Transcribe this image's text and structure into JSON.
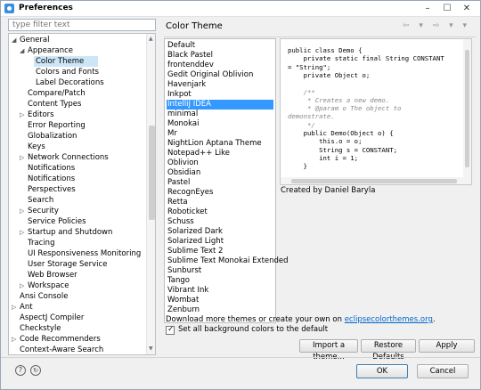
{
  "window": {
    "title": "Preferences"
  },
  "filter": {
    "placeholder": "type filter text"
  },
  "tree": [
    {
      "label": "General",
      "level": 0,
      "expanded": true
    },
    {
      "label": "Appearance",
      "level": 1,
      "expanded": true
    },
    {
      "label": "Color Theme",
      "level": 2,
      "selected": true
    },
    {
      "label": "Colors and Fonts",
      "level": 2
    },
    {
      "label": "Label Decorations",
      "level": 2
    },
    {
      "label": "Compare/Patch",
      "level": 1
    },
    {
      "label": "Content Types",
      "level": 1
    },
    {
      "label": "Editors",
      "level": 1,
      "expandable": true
    },
    {
      "label": "Error Reporting",
      "level": 1
    },
    {
      "label": "Globalization",
      "level": 1
    },
    {
      "label": "Keys",
      "level": 1
    },
    {
      "label": "Network Connections",
      "level": 1,
      "expandable": true
    },
    {
      "label": "Notifications",
      "level": 1
    },
    {
      "label": "Notifications",
      "level": 1
    },
    {
      "label": "Perspectives",
      "level": 1
    },
    {
      "label": "Search",
      "level": 1
    },
    {
      "label": "Security",
      "level": 1,
      "expandable": true
    },
    {
      "label": "Service Policies",
      "level": 1
    },
    {
      "label": "Startup and Shutdown",
      "level": 1,
      "expandable": true
    },
    {
      "label": "Tracing",
      "level": 1
    },
    {
      "label": "UI Responsiveness Monitoring",
      "level": 1
    },
    {
      "label": "User Storage Service",
      "level": 1
    },
    {
      "label": "Web Browser",
      "level": 1
    },
    {
      "label": "Workspace",
      "level": 1,
      "expandable": true
    },
    {
      "label": "Ansi Console",
      "level": 0
    },
    {
      "label": "Ant",
      "level": 0,
      "expandable": true
    },
    {
      "label": "AspectJ Compiler",
      "level": 0
    },
    {
      "label": "Checkstyle",
      "level": 0
    },
    {
      "label": "Code Recommenders",
      "level": 0,
      "expandable": true
    },
    {
      "label": "Context-Aware Search",
      "level": 0
    }
  ],
  "page": {
    "title": "Color Theme",
    "nav_icons": "⇦ ▾ ⇨ ▾ ▾"
  },
  "themes": [
    "Default",
    "Black Pastel",
    "frontenddev",
    "Gedit Original Oblivion",
    "Havenjark",
    "Inkpot",
    "IntelliJ IDEA",
    "minimal",
    "Monokai",
    "Mr",
    "NightLion Aptana Theme",
    "Notepad++ Like",
    "Oblivion",
    "Obsidian",
    "Pastel",
    "RecognEyes",
    "Retta",
    "Roboticket",
    "Schuss",
    "Solarized Dark",
    "Solarized Light",
    "Sublime Text 2",
    "Sublime Text Monokai Extended",
    "Sunburst",
    "Tango",
    "Vibrant Ink",
    "Wombat",
    "Zenburn"
  ],
  "selected_theme": "IntelliJ IDEA",
  "preview": {
    "lines": [
      {
        "text": "public class Demo {",
        "style": "kw"
      },
      {
        "text": "    private static final String CONSTANT",
        "style": "kw"
      },
      {
        "text": "= \"String\";",
        "style": "kw"
      },
      {
        "text": "    private Object o;",
        "style": "kw"
      },
      {
        "text": "",
        "style": "kw"
      },
      {
        "text": "    /**",
        "style": "cm"
      },
      {
        "text": "     * Creates a new demo.",
        "style": "cm"
      },
      {
        "text": "     * @param o The object to",
        "style": "cm"
      },
      {
        "text": "demonstrate.",
        "style": "cm"
      },
      {
        "text": "     */",
        "style": "cm"
      },
      {
        "text": "    public Demo(Object o) {",
        "style": "kw"
      },
      {
        "text": "        this.o = o;",
        "style": "kw"
      },
      {
        "text": "        String s = CONSTANT;",
        "style": "kw"
      },
      {
        "text": "        int i = 1;",
        "style": "kw"
      },
      {
        "text": "    }",
        "style": "kw"
      },
      {
        "text": "",
        "style": "kw"
      },
      {
        "text": "    public static void main(String[]",
        "style": "kw"
      }
    ]
  },
  "author": "Created by Daniel Baryla",
  "download": {
    "prefix": "Download more themes or create your own on ",
    "link": "eclipsecolorthemes.org",
    "suffix": "."
  },
  "set_all_bg": {
    "label": "Set all background colors to the default",
    "checked": true
  },
  "buttons": {
    "import": "Import a theme...",
    "restore": "Restore Defaults",
    "apply": "Apply",
    "ok": "OK",
    "cancel": "Cancel"
  },
  "colors": {
    "selection": "#3399ff",
    "tree_selection": "#cde6f7",
    "link": "#0066cc"
  }
}
